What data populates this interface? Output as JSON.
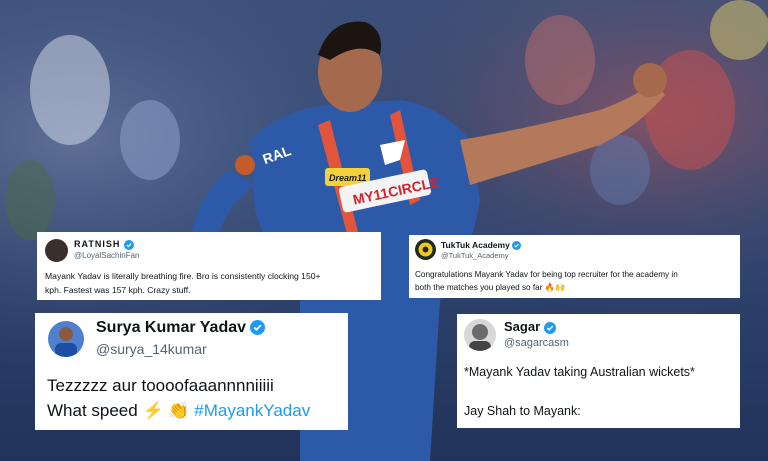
{
  "tweets": [
    {
      "name": "RATNISH",
      "handle": "@LoyalSachinFan",
      "text_line1": "Mayank Yadav is literally breathing fire. Bro is consistently clocking 150+",
      "text_line2": "kph. Fastest was 157 kph. Crazy stuff."
    },
    {
      "name": "TukTuk Academy",
      "handle": "@TukTuk_Academy",
      "text_line1": "Congratulations Mayank Yadav for being top recruiter for the academy in",
      "text_line2": "both the matches you played so far"
    },
    {
      "name": "Surya Kumar Yadav",
      "handle": "@surya_14kumar",
      "text_line1": "Tezzzzz aur toooofaaannnniiiii",
      "text_line2": "What speed",
      "hashtag": "#MayankYadav"
    },
    {
      "name": "Sagar",
      "handle": "@sagarcasm",
      "text_line1": "*Mayank Yadav taking Australian wickets*",
      "text_line2": "Jay Shah to Mayank:"
    }
  ],
  "jersey": {
    "sponsor_top": "Dream11",
    "sponsor_main": "MY11CIRCLE",
    "sleeve": "RAL"
  },
  "colors": {
    "verified": "#1d9bf0",
    "jersey": "#2d5aa8",
    "stripe": "#e3553a"
  }
}
